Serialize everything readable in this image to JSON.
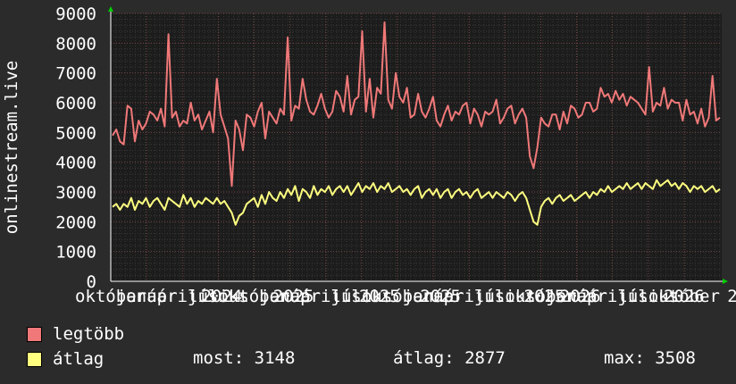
{
  "chart_data": {
    "type": "line",
    "ylabel": "onlinestream.live",
    "ylim": [
      0,
      9000
    ],
    "y_ticks": [
      "0",
      "1000",
      "2000",
      "3000",
      "4000",
      "5000",
      "6000",
      "7000",
      "8000",
      "9000"
    ],
    "x_tick_labels": [
      "október",
      "január",
      "április",
      "július",
      "október",
      "január",
      "április",
      "július",
      "október",
      "január",
      "április",
      "július",
      "október",
      "január",
      "április",
      "július",
      "október"
    ],
    "x_year_labels": [
      "2024",
      "2025",
      "2025",
      "2025",
      "2025",
      "2026",
      "2026"
    ],
    "x_tail_label": "2",
    "grid": true,
    "series": [
      {
        "name": "legtöbb",
        "color": "#f07878",
        "values": [
          4900,
          5100,
          4700,
          4600,
          5900,
          5800,
          4700,
          5400,
          5100,
          5300,
          5700,
          5600,
          5400,
          5800,
          5200,
          8300,
          5500,
          5700,
          5200,
          5400,
          5300,
          6000,
          5400,
          5600,
          5100,
          5400,
          5700,
          5000,
          6800,
          5600,
          5200,
          4800,
          3200,
          5400,
          5100,
          4400,
          5600,
          5500,
          5200,
          5700,
          6000,
          4800,
          5700,
          5500,
          5300,
          5800,
          5600,
          8200,
          5400,
          5900,
          5800,
          6800,
          6100,
          5700,
          5600,
          5900,
          6300,
          5800,
          5500,
          5700,
          6400,
          6200,
          5700,
          6900,
          5600,
          6100,
          6200,
          8400,
          5700,
          6800,
          5500,
          6500,
          6300,
          8700,
          6100,
          5800,
          7000,
          6200,
          6000,
          6500,
          5500,
          5600,
          6300,
          5700,
          5500,
          5800,
          6200,
          5400,
          5200,
          5600,
          5900,
          5400,
          5700,
          5600,
          5900,
          6000,
          5300,
          5800,
          5600,
          5200,
          5700,
          5600,
          5700,
          6100,
          5300,
          5500,
          5800,
          5900,
          5300,
          5600,
          5800,
          5500,
          4200,
          3800,
          4500,
          5500,
          5300,
          5200,
          5600,
          5600,
          5100,
          5700,
          5300,
          5900,
          5800,
          5500,
          5600,
          6000,
          6000,
          5700,
          5800,
          6500,
          6200,
          6300,
          6000,
          6400,
          6100,
          6300,
          5900,
          6200,
          6100,
          6000,
          5800,
          5600,
          7200,
          5700,
          6000,
          5900,
          6500,
          5800,
          6100,
          6000,
          6000,
          5400,
          6100,
          5600,
          5700,
          5300,
          5800,
          5200,
          5500,
          6900,
          5400,
          5500
        ]
      },
      {
        "name": "átlag",
        "color": "#ffff80",
        "values": [
          2500,
          2600,
          2400,
          2600,
          2500,
          2800,
          2400,
          2700,
          2600,
          2800,
          2500,
          2700,
          2800,
          2600,
          2400,
          2800,
          2700,
          2600,
          2500,
          2900,
          2600,
          2800,
          2500,
          2700,
          2600,
          2800,
          2700,
          2600,
          2800,
          2600,
          2700,
          2500,
          2300,
          1900,
          2200,
          2300,
          2600,
          2700,
          2800,
          2500,
          2900,
          2600,
          3000,
          2800,
          2700,
          3000,
          2800,
          3100,
          2900,
          3200,
          2700,
          3100,
          3000,
          2800,
          3200,
          2900,
          3100,
          3000,
          3200,
          2900,
          3100,
          3200,
          3000,
          3200,
          2900,
          3100,
          3300,
          3000,
          3200,
          3100,
          3300,
          3000,
          3200,
          3100,
          3300,
          3000,
          3100,
          3200,
          3000,
          3100,
          2900,
          3100,
          3200,
          2800,
          3000,
          3100,
          2900,
          3100,
          2800,
          3000,
          3100,
          2800,
          3000,
          3100,
          2900,
          3000,
          2800,
          3000,
          3100,
          2800,
          2900,
          3000,
          2800,
          3000,
          2900,
          2800,
          3000,
          2900,
          2700,
          2900,
          3000,
          2800,
          2400,
          2000,
          1900,
          2500,
          2700,
          2800,
          2600,
          2800,
          2900,
          2700,
          2800,
          2900,
          2700,
          2800,
          2900,
          3000,
          2800,
          3000,
          2900,
          3100,
          3000,
          3200,
          3000,
          3100,
          3200,
          3100,
          3300,
          3100,
          3200,
          3300,
          3100,
          3300,
          3200,
          3100,
          3400,
          3200,
          3300,
          3400,
          3200,
          3300,
          3100,
          3300,
          3200,
          3000,
          3200,
          3100,
          3200,
          3000,
          3100,
          3200,
          3000,
          3100
        ]
      }
    ]
  },
  "legend": {
    "items": [
      {
        "label": "legtöbb",
        "color": "#f07878"
      },
      {
        "label": "átlag",
        "color": "#ffff80"
      }
    ]
  },
  "stats": {
    "most": "most: 3148",
    "avg": "átlag: 2877",
    "max": "max: 3508"
  }
}
